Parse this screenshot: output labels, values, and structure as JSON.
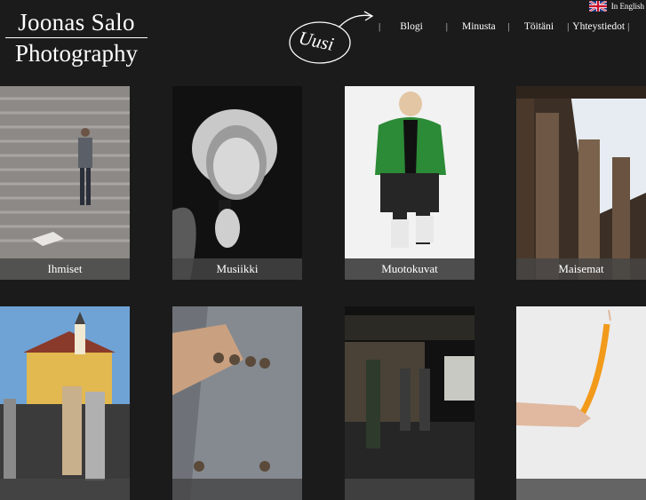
{
  "brand": {
    "line1": "Joonas Salo",
    "line2": "Photography"
  },
  "new_badge": {
    "label": "Uusi"
  },
  "language": {
    "label": "In English",
    "flag_icon": "uk-flag-icon"
  },
  "nav": {
    "separator": "|",
    "items": [
      {
        "label": "Blogi"
      },
      {
        "label": "Minusta"
      },
      {
        "label": "Töitäni"
      },
      {
        "label": "Yhteystiedot"
      }
    ]
  },
  "gallery": {
    "row1": [
      {
        "caption": "Ihmiset"
      },
      {
        "caption": "Musiikki"
      },
      {
        "caption": "Muotokuvat"
      },
      {
        "caption": "Maisemat"
      }
    ]
  },
  "colors": {
    "background": "#1b1b1b",
    "caption_bar": "#464646",
    "text": "#ffffff"
  }
}
